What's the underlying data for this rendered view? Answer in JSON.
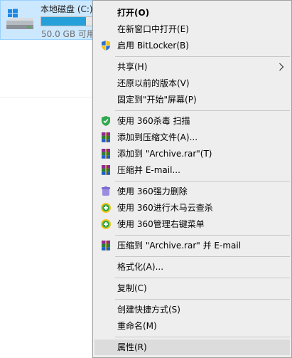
{
  "drive": {
    "name": "本地磁盘 (C:)",
    "free_text": "50.0 GB 可用",
    "usage_fraction": 0.85,
    "icon": "hard-drive-icon"
  },
  "menu": {
    "items": [
      {
        "label": "打开(O)",
        "bold": true,
        "icon": null
      },
      {
        "label": "在新窗口中打开(E)",
        "icon": null
      },
      {
        "label": "启用 BitLocker(B)",
        "icon": "uac-shield-icon"
      },
      {
        "label": "共享(H)",
        "icon": null,
        "submenu": true
      },
      {
        "label": "还原以前的版本(V)",
        "icon": null
      },
      {
        "label": "固定到\"开始\"屏幕(P)",
        "icon": null
      },
      {
        "label": "使用 360杀毒 扫描",
        "icon": "360-antivirus-icon"
      },
      {
        "label": "添加到压缩文件(A)...",
        "icon": "winrar-icon"
      },
      {
        "label": "添加到 \"Archive.rar\"(T)",
        "icon": "winrar-icon"
      },
      {
        "label": "压缩并 E-mail...",
        "icon": "winrar-icon"
      },
      {
        "label": "使用 360强力删除",
        "icon": "360-force-delete-icon"
      },
      {
        "label": "使用 360进行木马云查杀",
        "icon": "360-security-icon"
      },
      {
        "label": "使用 360管理右键菜单",
        "icon": "360-security-icon"
      },
      {
        "label": "压缩到 \"Archive.rar\" 并 E-mail",
        "icon": "winrar-icon"
      },
      {
        "label": "格式化(A)...",
        "icon": null
      },
      {
        "label": "复制(C)",
        "icon": null
      },
      {
        "label": "创建快捷方式(S)",
        "icon": null
      },
      {
        "label": "重命名(M)",
        "icon": null
      },
      {
        "label": "属性(R)",
        "icon": null,
        "highlighted": true
      }
    ]
  },
  "colors": {
    "menu_background": "#eeeeee",
    "highlight": "#dcdcdc",
    "drive_selection": "#cce8ff",
    "usage_bar": "#26a0da"
  }
}
